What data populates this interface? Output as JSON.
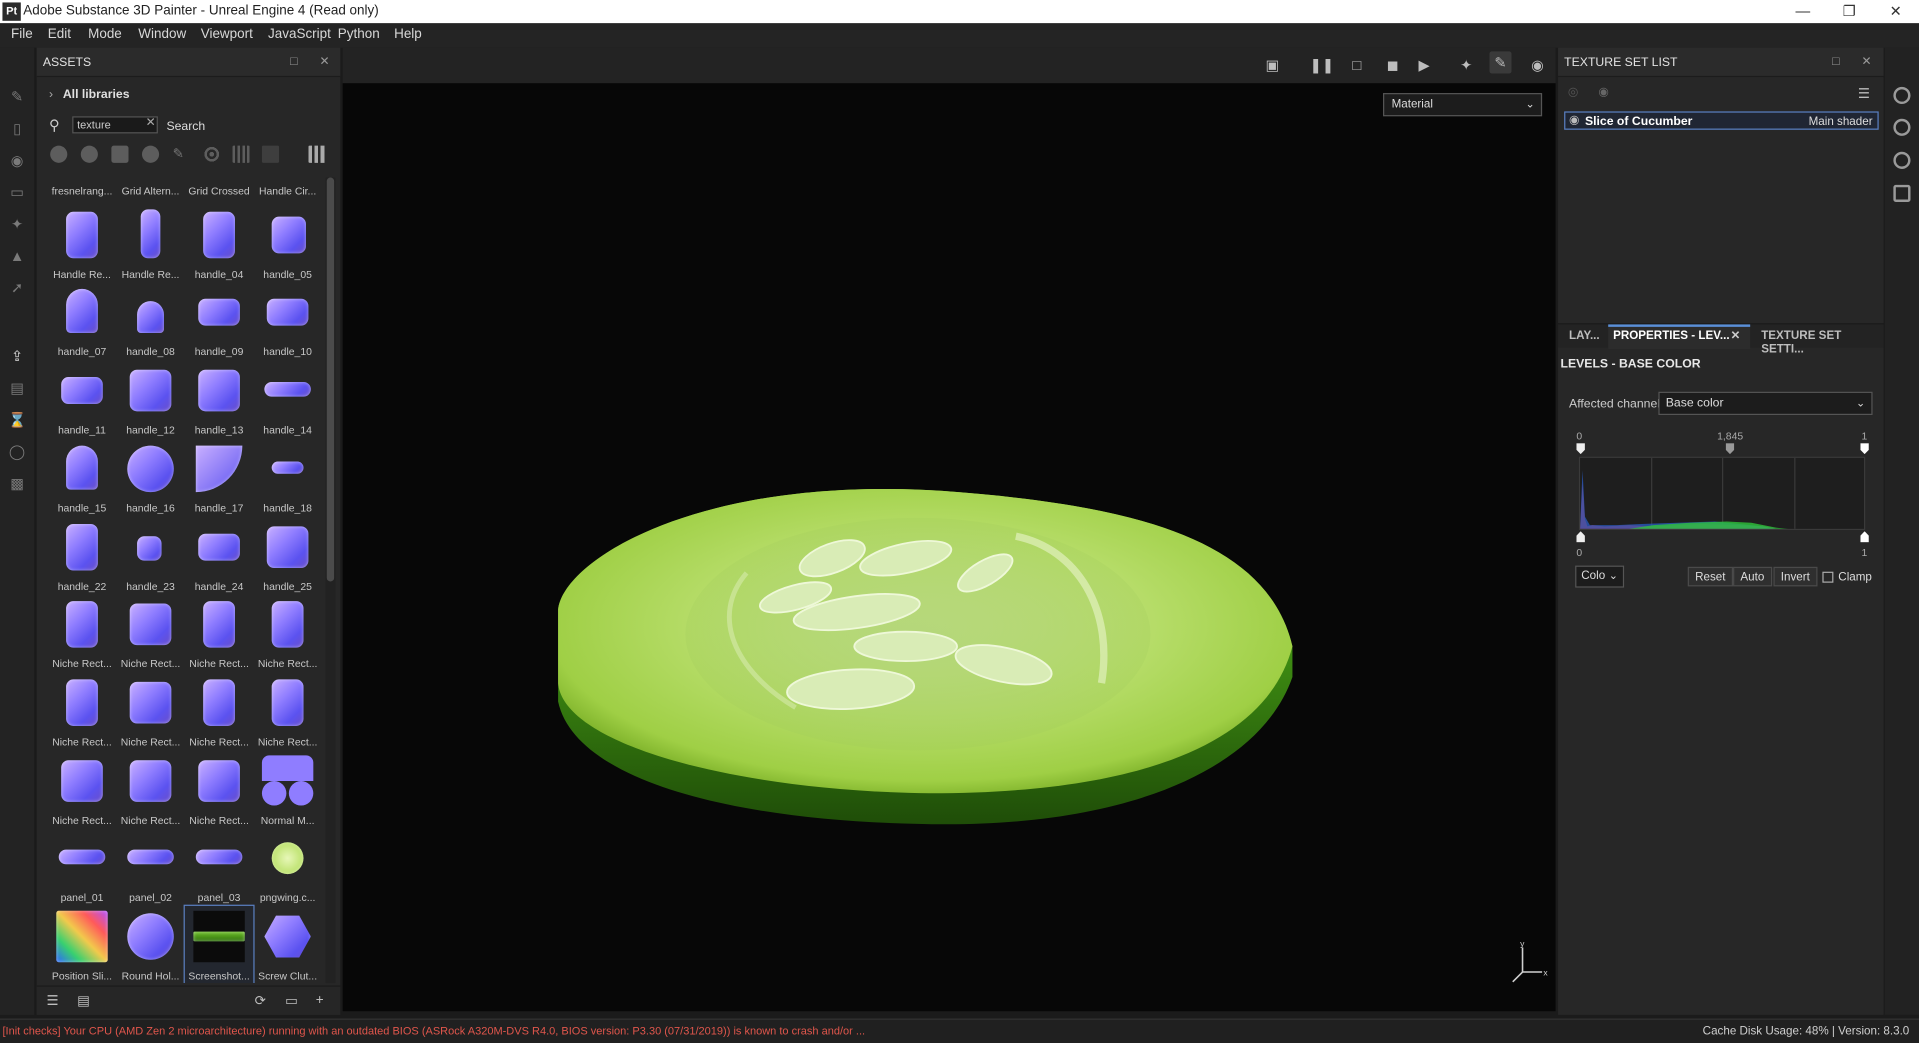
{
  "window": {
    "title": "Adobe Substance 3D Painter - Unreal Engine 4 (Read only)",
    "app_icon": "Pt"
  },
  "menu": [
    "File",
    "Edit",
    "Mode",
    "Window",
    "Viewport",
    "JavaScript",
    "Python",
    "Help"
  ],
  "assets": {
    "title": "ASSETS",
    "library": "All libraries",
    "search_value": "texture",
    "search_label": "Search",
    "items": [
      {
        "label": "fresnelrang...",
        "shape": "partial"
      },
      {
        "label": "Grid Altern...",
        "shape": "partial"
      },
      {
        "label": "Grid Crossed",
        "shape": "partial"
      },
      {
        "label": "Handle Cir...",
        "shape": "partial"
      },
      {
        "label": "Handle Re...",
        "shape": "tall"
      },
      {
        "label": "Handle Re...",
        "shape": "thin"
      },
      {
        "label": "handle_04",
        "shape": "tall"
      },
      {
        "label": "handle_05",
        "shape": "book"
      },
      {
        "label": "handle_07",
        "shape": "arch"
      },
      {
        "label": "handle_08",
        "shape": "arch-small"
      },
      {
        "label": "handle_09",
        "shape": "wide"
      },
      {
        "label": "handle_10",
        "shape": "wide"
      },
      {
        "label": "handle_11",
        "shape": "wide"
      },
      {
        "label": "handle_12",
        "shape": "square"
      },
      {
        "label": "handle_13",
        "shape": "square"
      },
      {
        "label": "handle_14",
        "shape": "pill"
      },
      {
        "label": "handle_15",
        "shape": "arch"
      },
      {
        "label": "handle_16",
        "shape": "circle"
      },
      {
        "label": "handle_17",
        "shape": "curve"
      },
      {
        "label": "handle_18",
        "shape": "pill-small"
      },
      {
        "label": "handle_22",
        "shape": "tall"
      },
      {
        "label": "handle_23",
        "shape": "small"
      },
      {
        "label": "handle_24",
        "shape": "wide"
      },
      {
        "label": "handle_25",
        "shape": "square"
      },
      {
        "label": "Niche Rect...",
        "shape": "tall"
      },
      {
        "label": "Niche Rect...",
        "shape": "square"
      },
      {
        "label": "Niche Rect...",
        "shape": "tall"
      },
      {
        "label": "Niche Rect...",
        "shape": "tall"
      },
      {
        "label": "Niche Rect...",
        "shape": "tall"
      },
      {
        "label": "Niche Rect...",
        "shape": "square"
      },
      {
        "label": "Niche Rect...",
        "shape": "tall"
      },
      {
        "label": "Niche Rect...",
        "shape": "tall"
      },
      {
        "label": "Niche Rect...",
        "shape": "square"
      },
      {
        "label": "Niche Rect...",
        "shape": "square"
      },
      {
        "label": "Niche Rect...",
        "shape": "square"
      },
      {
        "label": "Normal M...",
        "shape": "normal"
      },
      {
        "label": "panel_01",
        "shape": "pill"
      },
      {
        "label": "panel_02",
        "shape": "pill"
      },
      {
        "label": "panel_03",
        "shape": "pill"
      },
      {
        "label": "pngwing.c...",
        "shape": "cucumber"
      },
      {
        "label": "Position Sli...",
        "shape": "position"
      },
      {
        "label": "Round Hol...",
        "shape": "round"
      },
      {
        "label": "Screenshot...",
        "shape": "screenshot",
        "selected": true
      },
      {
        "label": "Screw Clut...",
        "shape": "screw"
      }
    ]
  },
  "viewport": {
    "material_select": "Material",
    "axis": {
      "x": "x",
      "y": "y"
    }
  },
  "texture_set_list": {
    "title": "TEXTURE SET LIST",
    "rows": [
      {
        "name": "Slice of Cucumber",
        "shader": "Main shader"
      }
    ]
  },
  "properties": {
    "tabs": [
      "LAY...",
      "PROPERTIES - LEV...",
      "TEXTURE SET SETTI..."
    ],
    "section_title": "LEVELS - BASE COLOR",
    "affected_label": "Affected channel:",
    "affected_value": "Base color",
    "input_min": "0",
    "input_mid": "1,845",
    "input_max": "1",
    "output_min": "0",
    "output_max": "1",
    "mode_select": "Colo",
    "buttons": {
      "reset": "Reset",
      "auto": "Auto",
      "invert": "Invert"
    },
    "clamp_label": "Clamp"
  },
  "status": {
    "warning": "[Init checks] Your CPU (AMD Zen 2 microarchitecture) running with an outdated BIOS (ASRock A320M-DVS R4.0, BIOS version: P3.30 (07/31/2019)) is known to crash and/or ...",
    "right": "Cache Disk Usage:   48% | Version: 8.3.0"
  },
  "colors": {
    "accent": "#5a8fd8",
    "warning": "#e0564c",
    "normal_map": "#8f7dff"
  }
}
